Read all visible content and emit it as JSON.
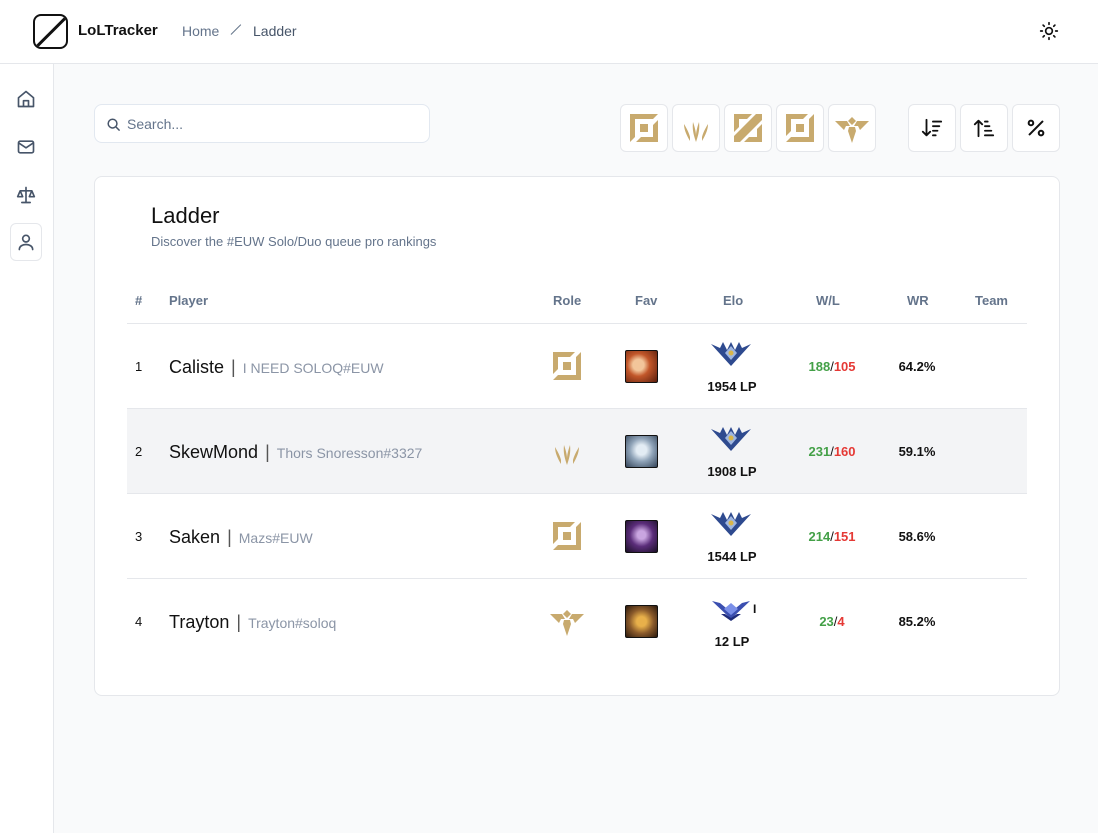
{
  "app": {
    "name": "LoLTracker"
  },
  "breadcrumb": {
    "home": "Home",
    "current": "Ladder"
  },
  "icons": {
    "logo": "slash-square-icon",
    "theme_toggle": "sun-icon",
    "sidebar": [
      "home-icon",
      "mail-icon",
      "scale-icon",
      "user-icon"
    ],
    "sort": [
      "sort-descending-icon",
      "sort-ascending-icon",
      "percent-icon"
    ]
  },
  "search": {
    "placeholder": "Search...",
    "value": ""
  },
  "role_filters": [
    "top-role-icon",
    "jungle-role-icon",
    "mid-role-icon",
    "bottom-role-icon",
    "support-role-icon"
  ],
  "colors": {
    "gold": "#c8aa6e",
    "win": "#43a047",
    "loss": "#e53935",
    "border": "#e5e7eb",
    "muted": "#64748b"
  },
  "ladder": {
    "title": "Ladder",
    "subtitle": "Discover the #EUW Solo/Duo queue pro rankings",
    "columns": {
      "rank": "#",
      "player": "Player",
      "role": "Role",
      "fav": "Fav",
      "elo": "Elo",
      "wl": "W/L",
      "wr": "WR",
      "team": "Team"
    },
    "rows": [
      {
        "rank": "1",
        "name": "Caliste",
        "tag": "I NEED SOLOQ#EUW",
        "role": "bottom",
        "elo_tier": "challenger",
        "elo_division": "",
        "lp": "1954 LP",
        "wins": "188",
        "sep": "/",
        "losses": "105",
        "wr": "64.2%",
        "team": "",
        "fav_color": "#b2451f"
      },
      {
        "rank": "2",
        "name": "SkewMond",
        "tag": "Thors Snoresson#3327",
        "role": "jungle",
        "elo_tier": "challenger",
        "elo_division": "",
        "lp": "1908 LP",
        "wins": "231",
        "sep": "/",
        "losses": "160",
        "wr": "59.1%",
        "team": "",
        "fav_color": "#8fa3b8"
      },
      {
        "rank": "3",
        "name": "Saken",
        "tag": "Mazs#EUW",
        "role": "bottom",
        "elo_tier": "challenger",
        "elo_division": "",
        "lp": "1544 LP",
        "wins": "214",
        "sep": "/",
        "losses": "151",
        "wr": "58.6%",
        "team": "",
        "fav_color": "#5b2d7a"
      },
      {
        "rank": "4",
        "name": "Trayton",
        "tag": "Trayton#soloq",
        "role": "support",
        "elo_tier": "diamond",
        "elo_division": "I",
        "lp": "12 LP",
        "wins": "23",
        "sep": "/",
        "losses": "4",
        "wr": "85.2%",
        "team": "",
        "fav_color": "#8a5a2b"
      }
    ]
  }
}
